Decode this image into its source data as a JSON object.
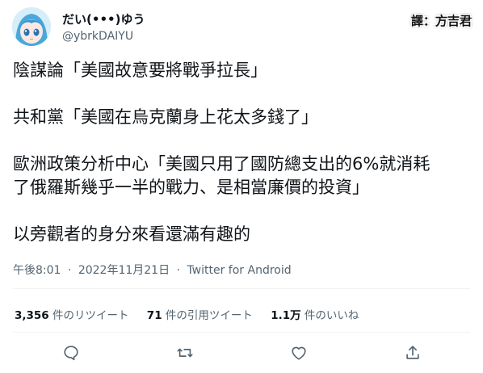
{
  "user": {
    "display_name": "だい(•••)ゆう",
    "handle": "@ybrkDAIYU"
  },
  "translator": "譯：方吉君",
  "tweet": {
    "line1": "陰謀論「美國故意要將戰爭拉長」",
    "line2": "共和黨「美國在烏克蘭身上花太多錢了」",
    "line3a": "歐洲政策分析中心「美國只用了國防總支出的6%就消耗",
    "line3b": "了俄羅斯幾乎一半的戰力、是相當廉價的投資」",
    "line4": "以旁觀者的身分來看還滿有趣的"
  },
  "meta": {
    "time": "午後8:01",
    "date": "2022年11月21日",
    "separator": "·",
    "source": "Twitter for Android"
  },
  "stats": {
    "retweets_count": "3,356",
    "retweets_label": "件のリツイート",
    "quotes_count": "71",
    "quotes_label": "件の引用ツイート",
    "likes_count": "1.1万",
    "likes_label": "件のいいね"
  },
  "actions": [
    "reply-icon",
    "retweet-icon",
    "like-icon",
    "share-icon"
  ],
  "colors": {
    "text": "#0f1419",
    "secondary": "#536471",
    "divider": "#eff3f4",
    "avatar_hair": "#4aa7dc"
  }
}
